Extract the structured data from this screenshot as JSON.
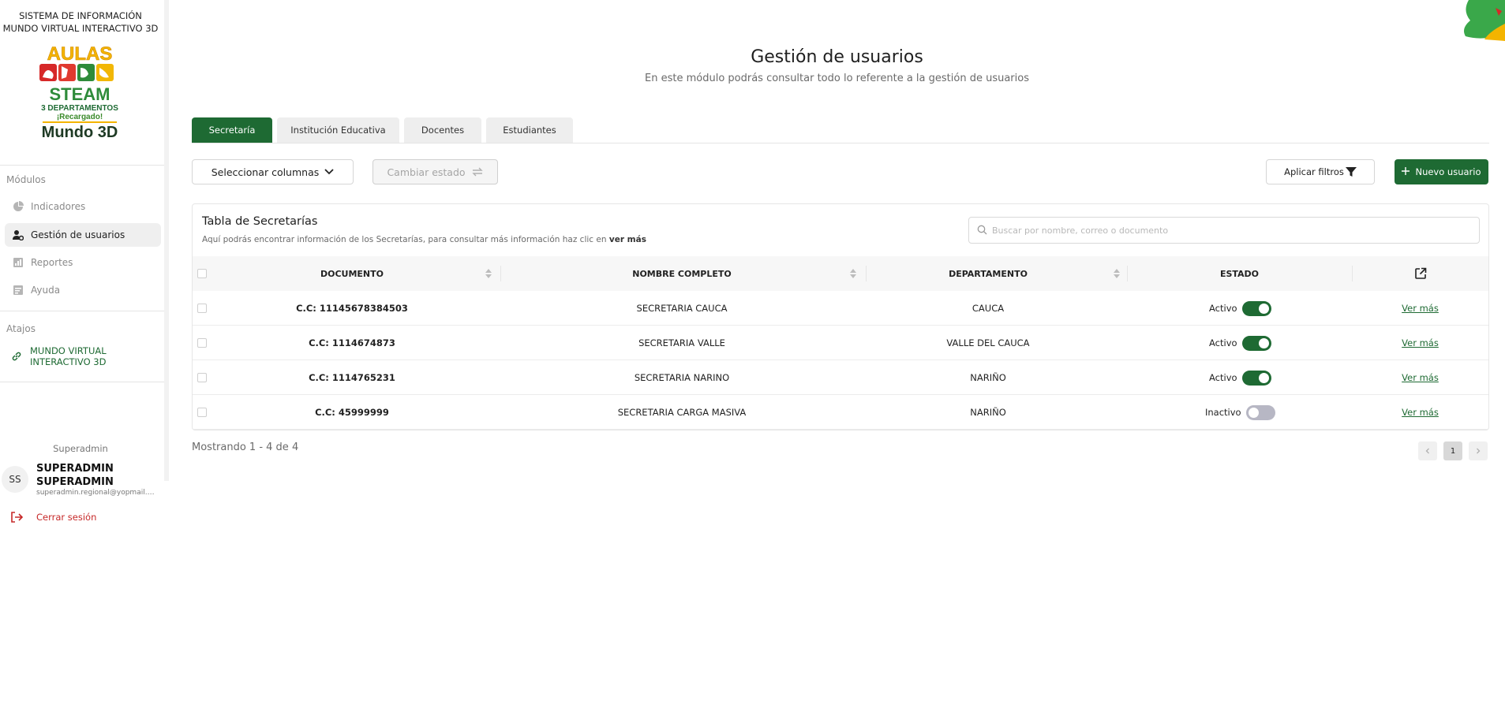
{
  "sidebar": {
    "system_title_line1": "SISTEMA DE INFORMACIÓN",
    "system_title_line2": "MUNDO VIRTUAL INTERACTIVO 3D",
    "logo_text": [
      "AULAS",
      "STEAM",
      "3 DEPARTAMENTOS",
      "¡Recargado!",
      "Mundo 3D"
    ],
    "modules_label": "Módulos",
    "items": [
      {
        "label": "Indicadores",
        "icon": "pie-chart-icon",
        "active": false
      },
      {
        "label": "Gestión de usuarios",
        "icon": "user-gear-icon",
        "active": true
      },
      {
        "label": "Reportes",
        "icon": "report-icon",
        "active": false
      },
      {
        "label": "Ayuda",
        "icon": "help-icon",
        "active": false
      }
    ],
    "shortcuts_label": "Atajos",
    "shortcut": {
      "line1": "MUNDO VIRTUAL",
      "line2": "INTERACTIVO 3D",
      "icon": "link-icon"
    },
    "user": {
      "role": "Superadmin",
      "initials": "SS",
      "name_line1": "SUPERADMIN",
      "name_line2": "SUPERADMIN",
      "email": "superadmin.regional@yopmail.com"
    },
    "logout_label": "Cerrar sesión"
  },
  "header": {
    "title": "Gestión de usuarios",
    "subtitle": "En este módulo podrás consultar todo lo referente a la gestión de usuarios"
  },
  "tabs": [
    "Secretaría",
    "Institución Educativa",
    "Docentes",
    "Estudiantes"
  ],
  "toolbar": {
    "select_columns": "Seleccionar columnas",
    "change_state": "Cambiar estado",
    "apply_filters": "Aplicar filtros",
    "new_user": "Nuevo usuario"
  },
  "table": {
    "title": "Tabla de Secretarías",
    "description": "Aquí podrás encontrar información de los Secretarías, para consultar más información haz clic en",
    "description_bold": "ver más",
    "search_placeholder": "Buscar por nombre, correo o documento",
    "columns": [
      "DOCUMENTO",
      "NOMBRE COMPLETO",
      "DEPARTAMENTO",
      "ESTADO"
    ],
    "rows": [
      {
        "documento": "C.C: 11145678384503",
        "nombre": "SECRETARIA CAUCA",
        "departamento": "CAUCA",
        "estado": "Activo",
        "on": true,
        "action": "Ver más"
      },
      {
        "documento": "C.C: 1114674873",
        "nombre": "SECRETARIA VALLE",
        "departamento": "VALLE DEL CAUCA",
        "estado": "Activo",
        "on": true,
        "action": "Ver más"
      },
      {
        "documento": "C.C: 1114765231",
        "nombre": "SECRETARIA NARINO",
        "departamento": "NARIÑO",
        "estado": "Activo",
        "on": true,
        "action": "Ver más"
      },
      {
        "documento": "C.C: 45999999",
        "nombre": "SECRETARIA CARGA MASIVA",
        "departamento": "NARIÑO",
        "estado": "Inactivo",
        "on": false,
        "action": "Ver más"
      }
    ],
    "footer": "Mostrando 1 - 4 de 4",
    "page": "1"
  },
  "colors": {
    "primary": "#1e6a33",
    "danger": "#c62828"
  }
}
